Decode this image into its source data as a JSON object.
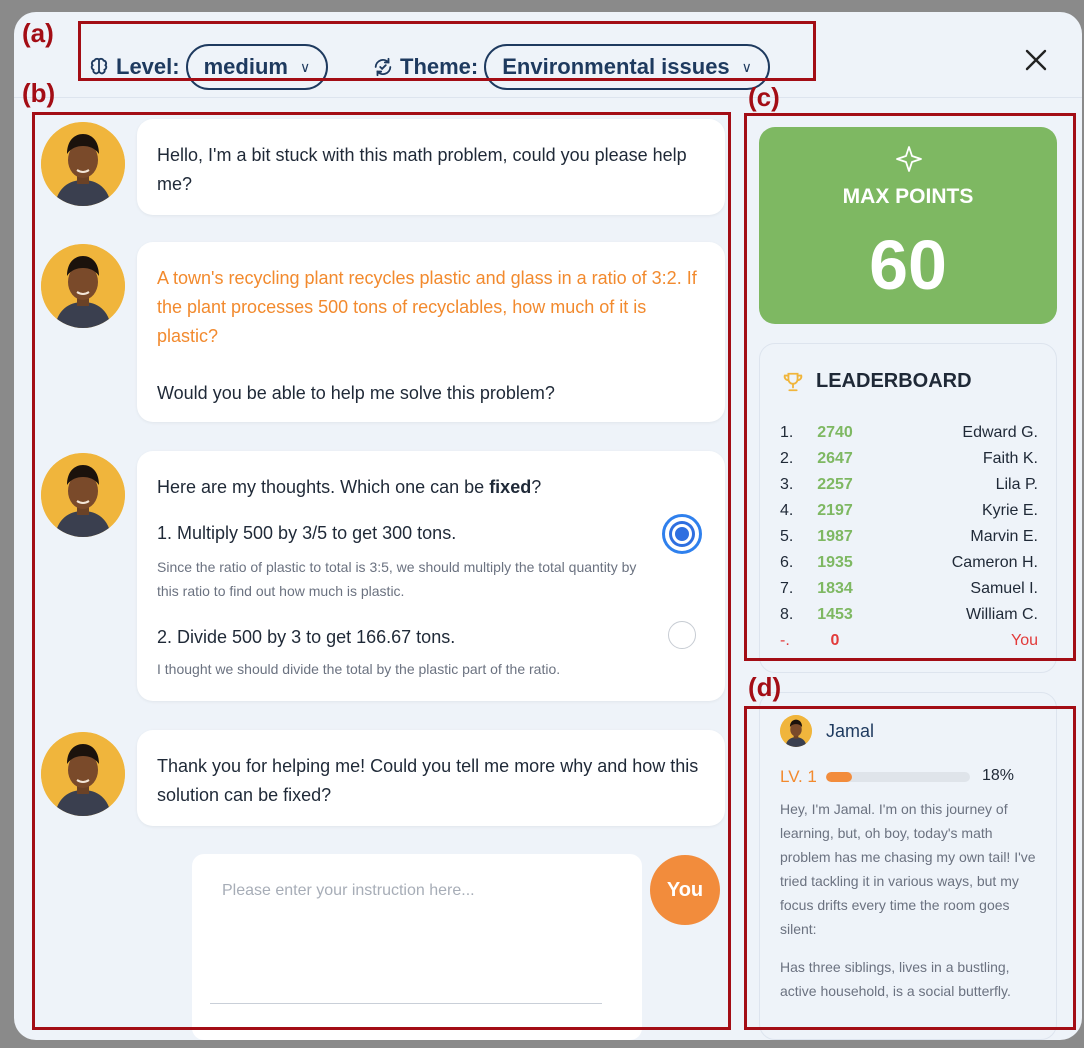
{
  "annotations": {
    "a": "(a)",
    "b": "(b)",
    "c": "(c)",
    "d": "(d)"
  },
  "header": {
    "level_label": "Level:",
    "level_value": "medium",
    "theme_label": "Theme:",
    "theme_value": "Environmental issues",
    "icons": {
      "level": "brain-icon",
      "theme": "refresh-icon",
      "close": "close-icon"
    }
  },
  "chat": {
    "messages": [
      {
        "text": "Hello, I'm a bit stuck with this math problem, could you please help me?"
      },
      {
        "problem": "A town's recycling plant recycles plastic and glass in a ratio of 3:2. If the plant processes 500 tons of recyclables, how much of it is plastic?",
        "text": "Would you be able to help me solve this problem?"
      },
      {
        "prompt_prefix": "Here are my thoughts. Which one can be ",
        "prompt_bold": "fixed",
        "prompt_suffix": "?",
        "options": [
          {
            "title": "1. Multiply 500 by 3/5 to get 300 tons.",
            "desc": "Since the ratio of plastic to total is 3:5, we should multiply the total quantity by this ratio to find out how much is plastic.",
            "selected": true
          },
          {
            "title": "2. Divide 500 by 3 to get 166.67 tons.",
            "desc": "I thought we should divide the total by the plastic part of the ratio.",
            "selected": false
          }
        ]
      },
      {
        "text": "Thank you for helping me! Could you tell me more why and how this solution can be fixed?"
      }
    ],
    "input_placeholder": "Please enter your instruction here...",
    "you_label": "You"
  },
  "max_points": {
    "label": "MAX POINTS",
    "value": "60"
  },
  "leaderboard": {
    "title": "LEADERBOARD",
    "rows": [
      {
        "rank": "1.",
        "score": "2740",
        "name": "Edward G."
      },
      {
        "rank": "2.",
        "score": "2647",
        "name": "Faith K."
      },
      {
        "rank": "3.",
        "score": "2257",
        "name": "Lila P."
      },
      {
        "rank": "4.",
        "score": "2197",
        "name": "Kyrie E."
      },
      {
        "rank": "5.",
        "score": "1987",
        "name": "Marvin E."
      },
      {
        "rank": "6.",
        "score": "1935",
        "name": "Cameron H."
      },
      {
        "rank": "7.",
        "score": "1834",
        "name": "Samuel I."
      },
      {
        "rank": "8.",
        "score": "1453",
        "name": "William C."
      },
      {
        "rank": "-.",
        "score": "0",
        "name": "You"
      }
    ]
  },
  "profile": {
    "name": "Jamal",
    "level": "LV. 1",
    "progress": 0.18,
    "progress_label": "18%",
    "bio": "Hey, I'm Jamal. I'm on this journey of learning, but, oh boy, today's math problem has me chasing my own tail! I've tried tackling it in various ways, but my focus drifts every time the room goes silent:",
    "traits": "Has three siblings, lives in a bustling, active household, is a social butterfly."
  },
  "colors": {
    "accent_green": "#7eb862",
    "accent_orange": "#f28c3c",
    "annotation_red": "#a30d15",
    "radio_blue": "#2f6fe0"
  }
}
